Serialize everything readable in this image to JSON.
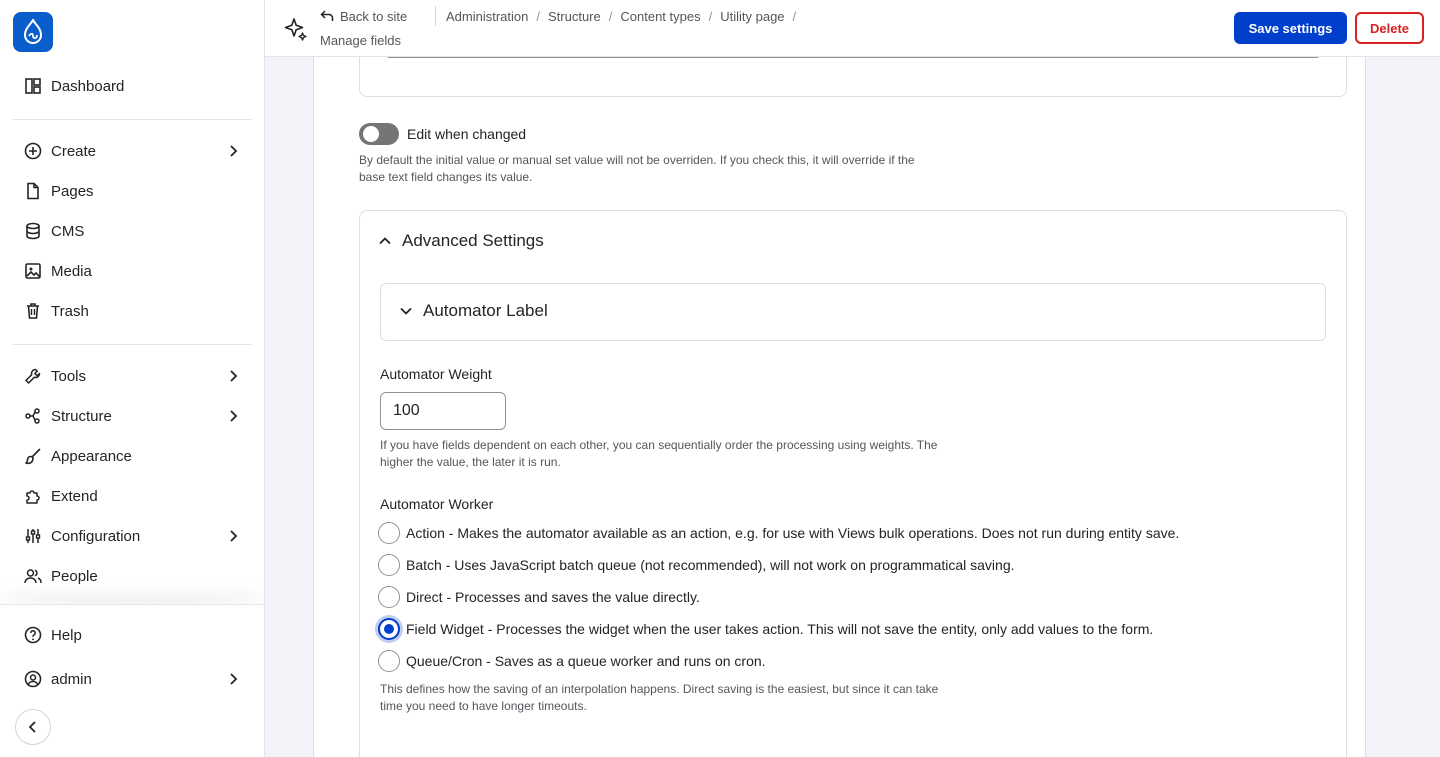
{
  "sidebar": {
    "items": [
      {
        "label": "Dashboard",
        "icon": "dashboard-icon"
      },
      {
        "label": "Create",
        "icon": "plus-circle-icon"
      },
      {
        "label": "Pages",
        "icon": "file-icon"
      },
      {
        "label": "CMS",
        "icon": "database-icon"
      },
      {
        "label": "Media",
        "icon": "image-icon"
      },
      {
        "label": "Trash",
        "icon": "trash-icon"
      },
      {
        "label": "Tools",
        "icon": "wrench-icon"
      },
      {
        "label": "Structure",
        "icon": "structure-icon"
      },
      {
        "label": "Appearance",
        "icon": "brush-icon"
      },
      {
        "label": "Extend",
        "icon": "puzzle-icon"
      },
      {
        "label": "Configuration",
        "icon": "sliders-icon"
      },
      {
        "label": "People",
        "icon": "people-icon"
      }
    ],
    "bottom": [
      {
        "label": "Help",
        "icon": "help-icon"
      },
      {
        "label": "admin",
        "icon": "user-circle-icon"
      }
    ]
  },
  "topbar": {
    "back": "Back to site",
    "breadcrumbs": [
      "Administration",
      "Structure",
      "Content types",
      "Utility page"
    ],
    "title": "Manage fields",
    "save": "Save settings",
    "delete": "Delete"
  },
  "form": {
    "edit_when_changed": {
      "label": "Edit when changed",
      "checked": false,
      "help_1": "By default the initial value or manual set value will not be overriden. If you check this, it will override if the",
      "help_2": "base text field changes its value."
    },
    "advanced_settings": {
      "title": "Advanced Settings",
      "automator_label": "Automator Label",
      "weight_label": "Automator Weight",
      "weight_value": "100",
      "weight_help_1": "If you have fields dependent on each other, you can sequentially order the processing using weights. The",
      "weight_help_2": "higher the value, the later it is run.",
      "worker_label": "Automator Worker",
      "worker_options": [
        {
          "label": "Action - Makes the automator available as an action, e.g. for use with Views bulk operations. Does not run during entity save.",
          "checked": false
        },
        {
          "label": "Batch - Uses JavaScript batch queue (not recommended), will not work on programmatical saving.",
          "checked": false
        },
        {
          "label": "Direct - Processes and saves the value directly.",
          "checked": false
        },
        {
          "label": "Field Widget - Processes the widget when the user takes action. This will not save the entity, only add values to the form.",
          "checked": true
        },
        {
          "label": "Queue/Cron - Saves as a queue worker and runs on cron.",
          "checked": false
        }
      ],
      "worker_help_1": "This defines how the saving of an interpolation happens. Direct saving is the easiest, but since it can take",
      "worker_help_2": "time you need to have longer timeouts."
    }
  },
  "colors": {
    "primary": "#003ecc",
    "danger": "#d72222",
    "logo": "#0a5ecc"
  }
}
